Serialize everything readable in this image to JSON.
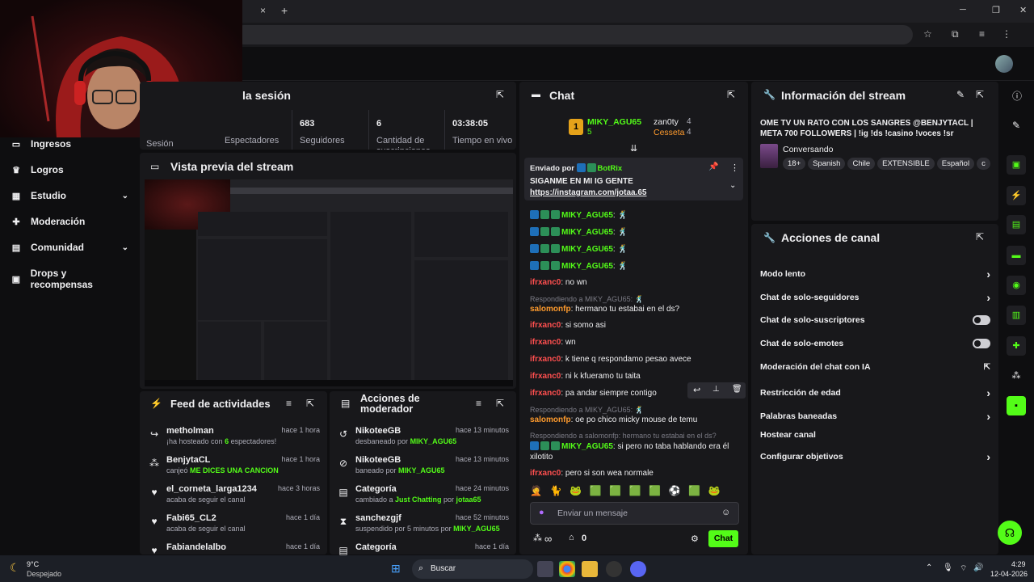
{
  "browser": {
    "tab_close": "×",
    "new_tab": "+",
    "win_min": "─",
    "win_max": "❐",
    "win_close": "✕"
  },
  "sidebar": {
    "items": [
      {
        "label": "Ingresos",
        "icon": "card-icon",
        "chev": ""
      },
      {
        "label": "Logros",
        "icon": "trophy-icon",
        "chev": ""
      },
      {
        "label": "Estudio",
        "icon": "studio-icon",
        "chev": "⌄"
      },
      {
        "label": "Moderación",
        "icon": "wrench-icon",
        "chev": ""
      },
      {
        "label": "Comunidad",
        "icon": "community-icon",
        "chev": "⌄"
      },
      {
        "label": "Drops y recompensas",
        "icon": "gift-icon",
        "chev": ""
      }
    ]
  },
  "session": {
    "title": "la sesión",
    "sesion_label": "Sesión",
    "stats": [
      {
        "value": "",
        "label": "Espectadores"
      },
      {
        "value": "683",
        "label": "Seguidores"
      },
      {
        "value": "6",
        "label": "Cantidad de suscripciones"
      },
      {
        "value": "03:38:05",
        "label": "Tiempo en vivo"
      }
    ]
  },
  "preview": {
    "title": "Vista previa del stream"
  },
  "feed": {
    "title": "Feed de actividades",
    "rows": [
      {
        "name": "metholman",
        "time": "hace 1 hora",
        "pre": "¡ha hosteado con ",
        "hl": "6",
        "post": " espectadores!",
        "icon": "↪"
      },
      {
        "name": "BenjytaCL",
        "time": "hace 1 hora",
        "pre": "canjeó ",
        "hl": "ME DICES UNA CANCION",
        "post": "",
        "icon": "⁂"
      },
      {
        "name": "el_corneta_larga1234",
        "time": "hace 3 horas",
        "pre": "acaba de seguir el canal",
        "hl": "",
        "post": "",
        "icon": "♥"
      },
      {
        "name": "Fabi65_CL2",
        "time": "hace 1 día",
        "pre": "acaba de seguir el canal",
        "hl": "",
        "post": "",
        "icon": "♥"
      },
      {
        "name": "Fabiandelalbo",
        "time": "hace 1 día",
        "pre": "",
        "hl": "",
        "post": "",
        "icon": "♥"
      }
    ]
  },
  "modactions": {
    "title": "Acciones de moderador",
    "rows": [
      {
        "name": "NikoteeGB",
        "time": "hace 13 minutos",
        "pre": "desbaneado por ",
        "hl": "MIKY_AGU65",
        "post": "",
        "icon": "↺"
      },
      {
        "name": "NikoteeGB",
        "time": "hace 13 minutos",
        "pre": "baneado por ",
        "hl": "MIKY_AGU65",
        "post": "",
        "icon": "⊘"
      },
      {
        "name": "Categoría",
        "time": "hace 24 minutos",
        "pre": "cambiado a ",
        "hl": "Just Chatting",
        "post": " por ",
        "hl2": "jotaa65",
        "icon": "▤"
      },
      {
        "name": "sanchezgjf",
        "time": "hace 52 minutos",
        "pre": "suspendido por 5 minutos por ",
        "hl": "MIKY_AGU65",
        "post": "",
        "icon": "⧗"
      },
      {
        "name": "Categoría",
        "time": "hace 1 día",
        "pre": "",
        "hl": "",
        "post": "",
        "icon": "▤"
      }
    ]
  },
  "chat": {
    "title": "Chat",
    "lead": [
      {
        "rank": "1",
        "name": "MIKY_AGU65",
        "count": "5"
      },
      {
        "name": "zan0ty",
        "count": "4"
      },
      {
        "name": "Cesseta",
        "count": "4"
      }
    ],
    "pinned": {
      "by_label": "Enviado por",
      "by_user": "BotRix",
      "text": "SIGANME EN MI IG GENTE",
      "link": "https://instagram.com/jotaa.65"
    },
    "messages": [
      {
        "user": "MIKY_AGU65",
        "text": "🕺",
        "cls": "green",
        "badges": true
      },
      {
        "user": "MIKY_AGU65",
        "text": "🕺",
        "cls": "green",
        "badges": true
      },
      {
        "user": "MIKY_AGU65",
        "text": "🕺",
        "cls": "green",
        "badges": true
      },
      {
        "user": "MIKY_AGU65",
        "text": "🕺",
        "cls": "green",
        "badges": true
      },
      {
        "user": "ifrxanc0",
        "text": "no wn",
        "cls": "red"
      },
      {
        "reply": "Respondiendo a MIKY_AGU65: 🕺",
        "user": "salomonfp",
        "text": "hermano tu estabai en el ds?",
        "cls": "orange"
      },
      {
        "user": "ifrxanc0",
        "text": "si somo asi",
        "cls": "red"
      },
      {
        "user": "ifrxanc0",
        "text": "wn",
        "cls": "red"
      },
      {
        "user": "ifrxanc0",
        "text": "k tiene q respondamo pesao avece",
        "cls": "red"
      },
      {
        "user": "ifrxanc0",
        "text": "ni k kfueramo tu taita",
        "cls": "red"
      },
      {
        "user": "ifrxanc0",
        "text": "pa andar siempre contigo",
        "cls": "red"
      },
      {
        "reply": "Respondiendo a MIKY_AGU65: 🕺",
        "user": "salomonfp",
        "text": "oe po chico micky mouse de temu",
        "cls": "orange"
      },
      {
        "reply": "Respondiendo a salomonfp: hermano tu estabai en el ds?",
        "user": "MIKY_AGU65",
        "text": "si pero no taba hablando era él",
        "text2": "xilotito",
        "cls": "green",
        "badges": true
      },
      {
        "user": "ifrxanc0",
        "text": "pero si son wea normale",
        "cls": "red"
      }
    ],
    "emotes": [
      "🤦",
      "🐈",
      "🐸",
      "🟩",
      "🟩",
      "🟩",
      "🟩",
      "⚽",
      "🟩",
      "🐸"
    ],
    "input_placeholder": "Enviar un mensaje",
    "points": "∞",
    "gift_count": "0",
    "send_label": "Chat"
  },
  "info": {
    "title": "Información del stream",
    "stream_title": "OME TV UN RATO CON LOS SANGRES @BENJYTACL | META 700 FOLLOWERS | !ig !ds !casino !voces !sr",
    "category": "Conversando",
    "tags": [
      "18+",
      "Spanish",
      "Chile",
      "EXTENSIBLE",
      "Español",
      "c"
    ]
  },
  "channel": {
    "title": "Acciones de canal",
    "rows": [
      {
        "label": "Modo lento",
        "right": "chevron"
      },
      {
        "label": "Chat de solo-seguidores",
        "right": "chevron"
      },
      {
        "label": "Chat de solo-suscriptores",
        "right": "toggle"
      },
      {
        "label": "Chat de solo-emotes",
        "right": "toggle"
      },
      {
        "label": "Moderación del chat con IA",
        "right": "external"
      },
      {
        "label": "Restricción de edad",
        "right": "chevron"
      },
      {
        "label": "Palabras baneadas",
        "right": "chevron"
      },
      {
        "label": "Hostear canal",
        "right": ""
      },
      {
        "label": "Configurar objetivos",
        "right": "chevron"
      }
    ]
  },
  "taskbar": {
    "temp": "9°C",
    "weather": "Despejado",
    "search": "Buscar",
    "time": "4:29",
    "date": "12-04-2026"
  },
  "colors": {
    "accent": "#53fc18",
    "panel": "#18181b",
    "bg": "#0e0e10"
  }
}
